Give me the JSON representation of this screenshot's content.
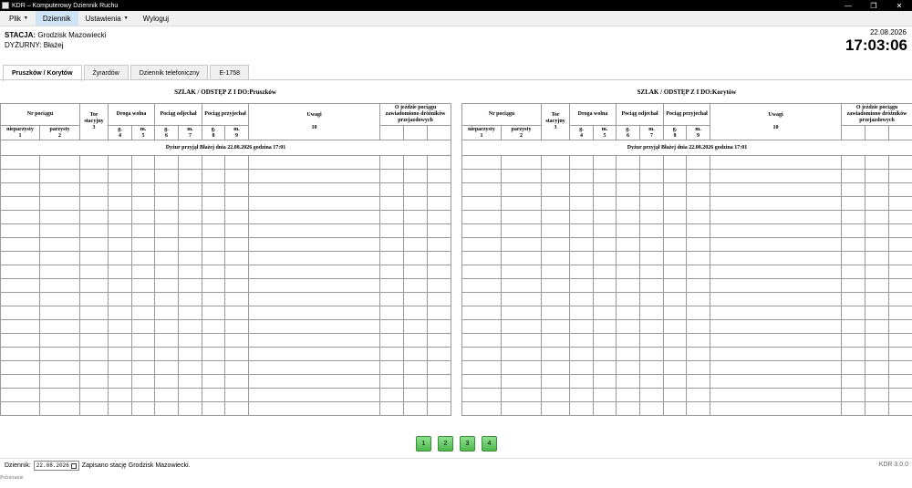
{
  "window": {
    "title": "KDR – Komputerowy Dziennik Ruchu"
  },
  "menu": {
    "items": [
      "Plik",
      "Dziennik",
      "Ustawienia",
      "Wyloguj"
    ]
  },
  "header": {
    "station_label": "STACJA:",
    "station": "Grodzisk Mazowiecki",
    "duty_label": "DYŻURNY:",
    "duty": "Błażej",
    "date": "22.08.2026",
    "time": "17:03:06"
  },
  "tabs": [
    "Pruszków / Korytów",
    "Żyrardów",
    "Dziennik telefoniczny",
    "E-1758"
  ],
  "table": {
    "col_nr": "Nr pociągu",
    "col_tor": "Tor stacyjny",
    "col_droga": "Droga wolna",
    "col_odjechal": "Pociąg odjechał",
    "col_przyjechal": "Pociąg przyjechał",
    "col_uwagi": "Uwagi",
    "col_uwagi_num": "10",
    "col_zawiad": "O jeździe pociągu zawiadomiono dróżników przejazdowych",
    "col_nieparzysty": "nieparzysty",
    "col_parzysty": "parzysty",
    "g": "g.",
    "m": "m.",
    "n1": "1",
    "n2": "2",
    "n3": "3",
    "n4": "4",
    "n5": "5",
    "n6": "6",
    "n7": "7",
    "n8": "8",
    "n9": "9",
    "duty_entry": "Dyżur przyjął Błażej dnia 22.08.2026 godzina 17:01"
  },
  "panels": {
    "left_title": "SZLAK / ODSTĘP Z I DO:Pruszków",
    "right_title": "SZLAK / ODSTĘP Z I DO:Korytów"
  },
  "pages": [
    "1",
    "2",
    "3",
    "4"
  ],
  "status": {
    "label": "Dziennik:",
    "date_value": "22.08.2026",
    "message": "Zapisano stację Grodzisk Mazowiecki.",
    "version": "KDR 3.0.0",
    "loading": "Pobieranie"
  }
}
